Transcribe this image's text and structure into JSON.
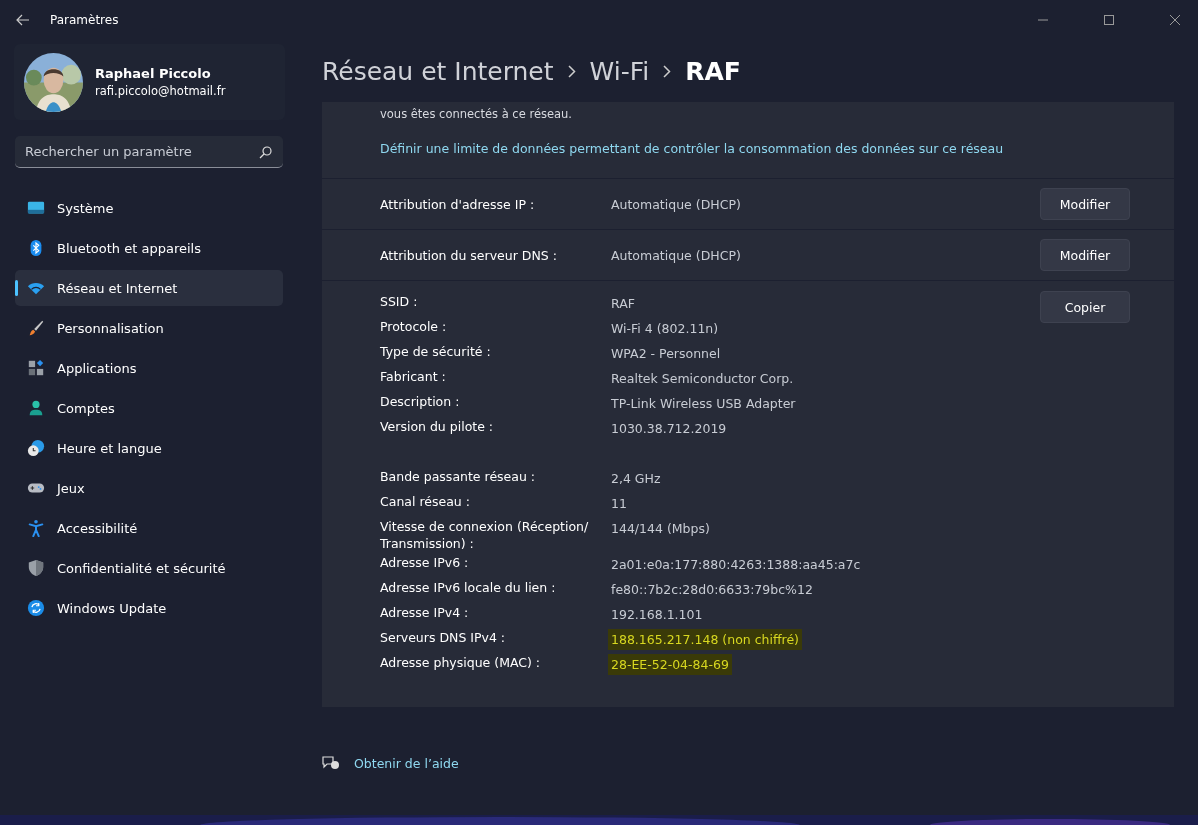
{
  "window": {
    "title": "Paramètres"
  },
  "user": {
    "name": "Raphael Piccolo",
    "email": "rafi.piccolo@hotmail.fr"
  },
  "search": {
    "placeholder": "Rechercher un paramètre"
  },
  "sidebar": {
    "items": [
      {
        "label": "Système",
        "selected": false
      },
      {
        "label": "Bluetooth et appareils",
        "selected": false
      },
      {
        "label": "Réseau et Internet",
        "selected": true
      },
      {
        "label": "Personnalisation",
        "selected": false
      },
      {
        "label": "Applications",
        "selected": false
      },
      {
        "label": "Comptes",
        "selected": false
      },
      {
        "label": "Heure et langue",
        "selected": false
      },
      {
        "label": "Jeux",
        "selected": false
      },
      {
        "label": "Accessibilité",
        "selected": false
      },
      {
        "label": "Confidentialité et sécurité",
        "selected": false
      },
      {
        "label": "Windows Update",
        "selected": false
      }
    ]
  },
  "breadcrumb": [
    "Réseau et Internet",
    "Wi-Fi",
    "RAF"
  ],
  "metered": {
    "description": "vous êtes connectés à ce réseau.",
    "link": "Définir une limite de données permettant de contrôler la consommation des données sur ce réseau"
  },
  "settings": [
    {
      "label": "Attribution d'adresse IP :",
      "value": "Automatique (DHCP)",
      "button": "Modifier"
    },
    {
      "label": "Attribution du serveur DNS :",
      "value": "Automatique (DHCP)",
      "button": "Modifier"
    }
  ],
  "properties": {
    "button": "Copier",
    "groups": [
      [
        {
          "label": "SSID :",
          "value": "RAF",
          "highlighted": false
        },
        {
          "label": "Protocole :",
          "value": "Wi-Fi 4 (802.11n)",
          "highlighted": false
        },
        {
          "label": "Type de sécurité :",
          "value": "WPA2 - Personnel",
          "highlighted": false
        },
        {
          "label": "Fabricant :",
          "value": "Realtek Semiconductor Corp.",
          "highlighted": false
        },
        {
          "label": "Description :",
          "value": "TP-Link Wireless USB Adapter",
          "highlighted": false
        },
        {
          "label": "Version du pilote :",
          "value": "1030.38.712.2019",
          "highlighted": false
        }
      ],
      [
        {
          "label": "Bande passante réseau :",
          "value": "2,4 GHz",
          "highlighted": false
        },
        {
          "label": "Canal réseau :",
          "value": "11",
          "highlighted": false
        },
        {
          "label": "Vitesse de connexion (Réception/ Transmission) :",
          "value": "144/144 (Mbps)",
          "highlighted": false
        },
        {
          "label": "Adresse IPv6 :",
          "value": "2a01:e0a:177:880:4263:1388:aa45:a7c",
          "highlighted": false
        },
        {
          "label": "Adresse IPv6 locale du lien :",
          "value": "fe80::7b2c:28d0:6633:79bc%12",
          "highlighted": false
        },
        {
          "label": "Adresse IPv4 :",
          "value": "192.168.1.101",
          "highlighted": false
        },
        {
          "label": "Serveurs DNS IPv4 :",
          "value": "188.165.217.148 (non chiffré)",
          "highlighted": true
        },
        {
          "label": "Adresse physique (MAC) :",
          "value": "28-EE-52-04-84-69",
          "highlighted": true
        }
      ]
    ]
  },
  "help": {
    "label": "Obtenir de l’aide"
  }
}
